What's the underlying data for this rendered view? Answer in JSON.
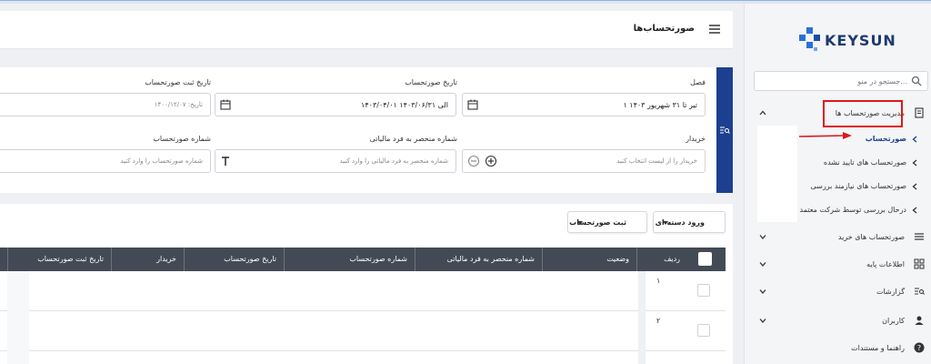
{
  "header": {
    "title": "صورتحساب‌ها"
  },
  "sidebar": {
    "logo_text": "KEYSUN",
    "search_placeholder": "جستجو در منو...",
    "menu": [
      {
        "label": "مدیریت صورتحساب ها"
      },
      {
        "label": "صورتحساب های خرید"
      },
      {
        "label": "اطلاعات پایه"
      },
      {
        "label": "گزارشات"
      },
      {
        "label": "کاربران"
      },
      {
        "label": "راهنما و مستندات"
      }
    ],
    "submenu": [
      {
        "label": "صورتحساب"
      },
      {
        "label": "صورتحساب های تایید نشده"
      },
      {
        "label": "صورتحساب های نیازمند بررسی"
      },
      {
        "label": "درحال بررسی توسط شرکت معتمد"
      }
    ]
  },
  "filters": {
    "season_label": "فصل",
    "season_value": "۱ تیر تا ۳۱ شهریور ۱۴۰۳",
    "invoice_date_label": "تاریخ صورتحساب",
    "invoice_date_value": "۱۴۰۳/۰۴/۰۱ الی ۱۴۰۳/۰۶/۳۱",
    "register_date_label": "تاریخ ثبت صورتحساب",
    "register_date_value": "تاریخ: ۱۴۰۰/۱۲/۰۷",
    "buyer_label": "خریدار",
    "buyer_placeholder": "خریدار را از لیست انتخاب کنید",
    "tax_id_label": "شماره منحصر به فرد مالیاتی",
    "tax_id_placeholder": "شماره منحصر به فرد مالیاتی را وارد کنید",
    "invoice_no_label": "شماره صورتحساب",
    "invoice_no_placeholder": "شماره صورتحساب را وارد کنید"
  },
  "toolbar": {
    "bulk_import_label": "ورود دسته ای",
    "register_invoice_label": "ثبت صورتحساب"
  },
  "table": {
    "columns": [
      "ردیف",
      "وضعیت",
      "شماره منحصر به فرد مالیاتی",
      "شماره صورتحساب",
      "تاریخ صورتحساب",
      "خریدار",
      "تاریخ ثبت صورتحساب"
    ],
    "rows": [
      {
        "index": "۱"
      },
      {
        "index": "۲"
      }
    ]
  },
  "colors": {
    "accent": "#1c3f8f",
    "header_bg": "#424a55",
    "highlight": "#e01818",
    "logo_blue": "#2b6fd6"
  }
}
